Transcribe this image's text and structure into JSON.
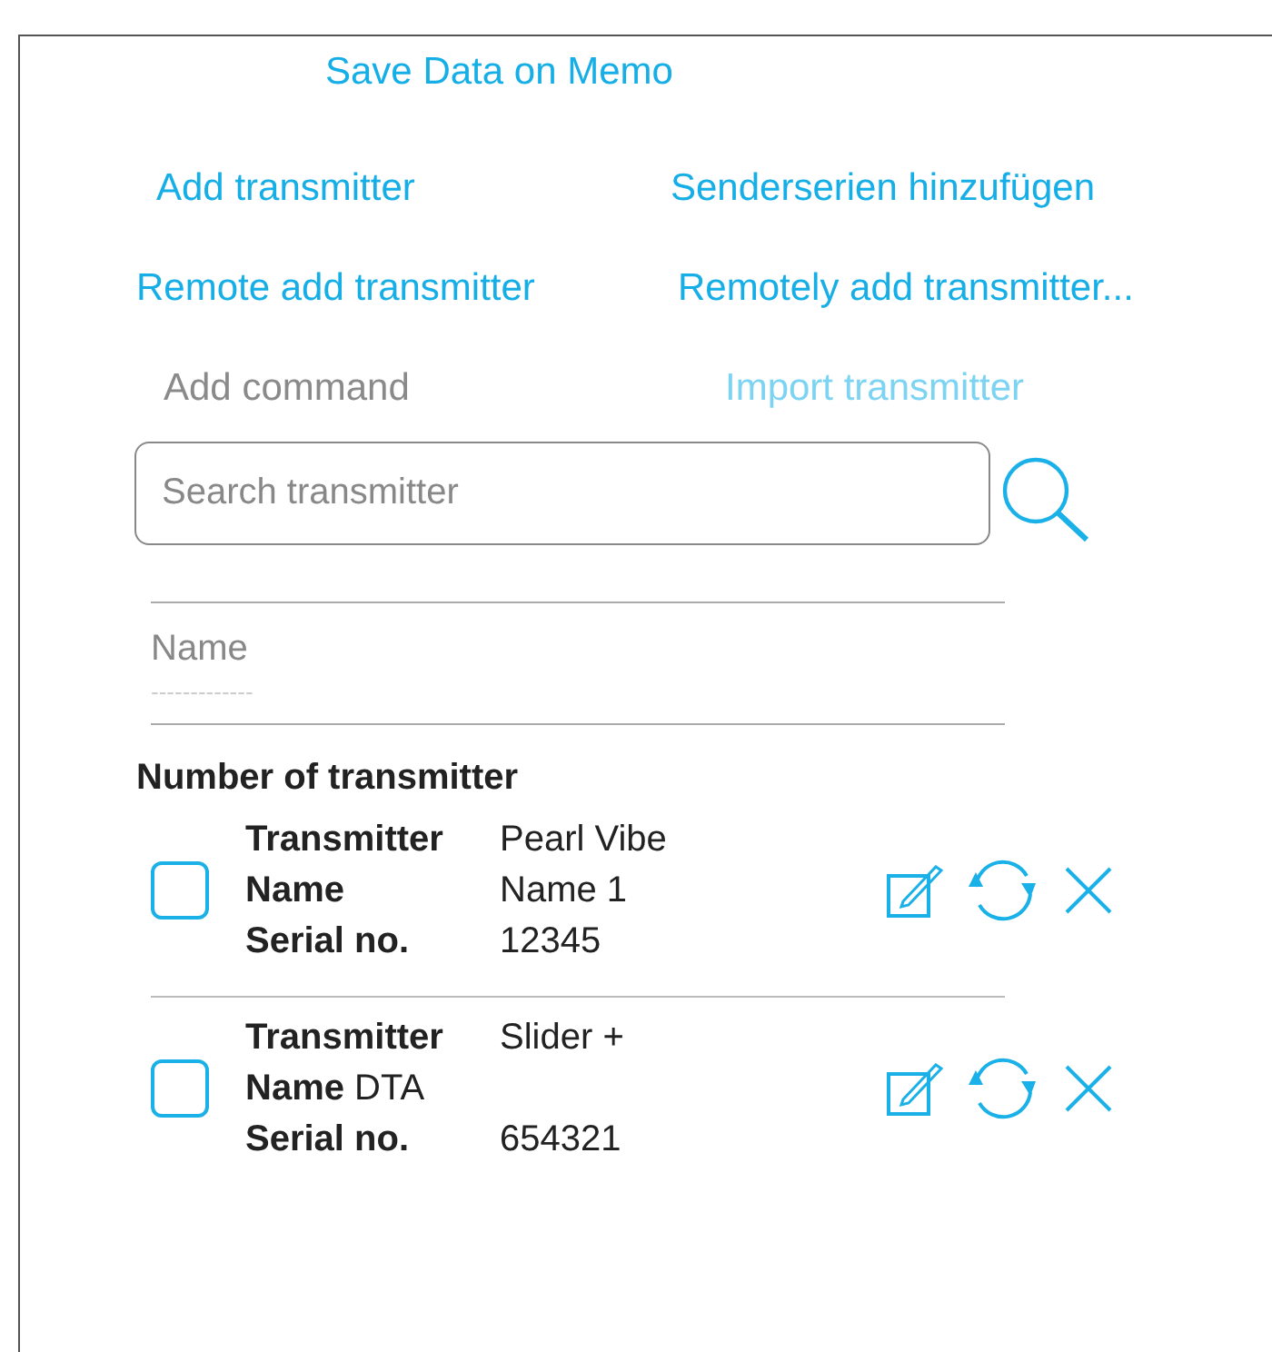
{
  "title_action": "Save Data on Memo",
  "actions": [
    {
      "label": "Add transmitter",
      "kind": "link"
    },
    {
      "label": "Senderserien hinzufügen",
      "kind": "link"
    },
    {
      "label": "Remote add transmitter",
      "kind": "link"
    },
    {
      "label": "Remotely add transmitter...",
      "kind": "link"
    },
    {
      "label": "Add command",
      "kind": "plain"
    },
    {
      "label": "Import transmitter",
      "kind": "faded"
    }
  ],
  "search": {
    "placeholder": "Search transmitter"
  },
  "name_field": {
    "label": "Name",
    "placeholder": "-------------"
  },
  "list_heading": "Number of transmitter",
  "transmitters": [
    {
      "checked": false,
      "fields": [
        {
          "label": "Transmitter",
          "value": "Pearl Vibe",
          "kind": "column"
        },
        {
          "label": "Name",
          "value": "Name 1",
          "kind": "column"
        },
        {
          "label": "Serial no.",
          "value": "12345",
          "kind": "column"
        }
      ]
    },
    {
      "checked": false,
      "fields": [
        {
          "label": "Transmitter",
          "value": "Slider +",
          "kind": "column"
        },
        {
          "label": "Name",
          "value": "DTA",
          "kind": "inline"
        },
        {
          "label": "Serial no.",
          "value": "654321",
          "kind": "column"
        }
      ]
    }
  ]
}
